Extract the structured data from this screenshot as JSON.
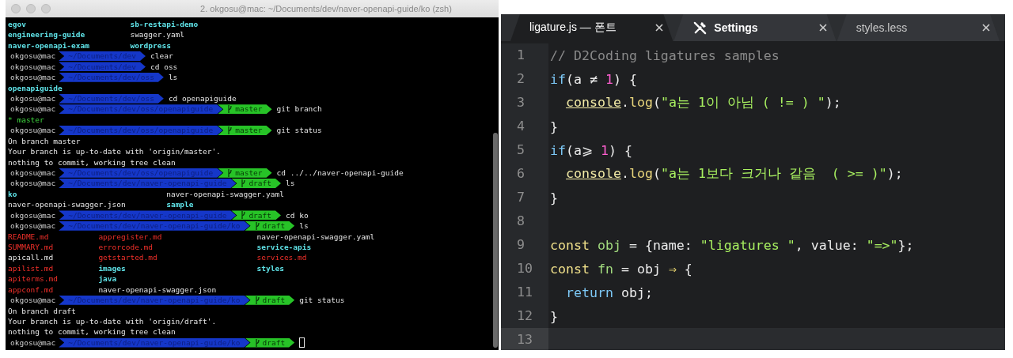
{
  "terminal": {
    "title": "2. okgosu@mac: ~/Documents/dev/naver-openapi-guide/ko (zsh)",
    "lines": [
      {
        "kind": "listing",
        "rows": [
          [
            {
              "text": "egov",
              "kind": "dir"
            },
            {
              "text": "sb-restapi-demo",
              "kind": "dir"
            }
          ],
          [
            {
              "text": "engineering-guide",
              "kind": "dir"
            },
            {
              "text": "swagger.yaml",
              "kind": "file"
            }
          ],
          [
            {
              "text": "naver-openapi-exam",
              "kind": "dir"
            },
            {
              "text": "wordpress",
              "kind": "dir"
            }
          ]
        ]
      },
      {
        "kind": "prompt",
        "user": "okgosu@mac",
        "path": "~/Documents/dev",
        "command": "clear",
        "cursor": false
      },
      {
        "kind": "prompt",
        "user": "okgosu@mac",
        "path": "~/Documents/dev",
        "command": "cd oss",
        "cursor": false
      },
      {
        "kind": "prompt",
        "user": "okgosu@mac",
        "path": "~/Documents/dev/oss",
        "command": "ls",
        "cursor": false
      },
      {
        "kind": "listing",
        "rows": [
          [
            {
              "text": "openapiguide",
              "kind": "dir"
            }
          ]
        ]
      },
      {
        "kind": "prompt",
        "user": "okgosu@mac",
        "path": "~/Documents/dev/oss",
        "command": "cd openapiguide",
        "cursor": false
      },
      {
        "kind": "prompt",
        "user": "okgosu@mac",
        "path": "~/Documents/dev/oss/openapiguide",
        "branch": "master",
        "command": "git branch",
        "cursor": false
      },
      {
        "kind": "current-branch",
        "text": "* master"
      },
      {
        "kind": "prompt",
        "user": "okgosu@mac",
        "path": "~/Documents/dev/oss/openapiguide",
        "branch": "master",
        "command": "git status",
        "cursor": false
      },
      {
        "kind": "text",
        "text": "On branch master"
      },
      {
        "kind": "text",
        "text": "Your branch is up-to-date with 'origin/master'."
      },
      {
        "kind": "text",
        "text": "nothing to commit, working tree clean"
      },
      {
        "kind": "prompt",
        "user": "okgosu@mac",
        "path": "~/Documents/dev/oss/openapiguide",
        "branch": "master",
        "command": "cd ../../naver-openapi-guide",
        "cursor": false
      },
      {
        "kind": "prompt",
        "user": "okgosu@mac",
        "path": "~/Documents/dev/naver-openapi-guide",
        "branch": "draft",
        "command": "ls",
        "cursor": false
      },
      {
        "kind": "listing",
        "rows": [
          [
            {
              "text": "ko",
              "kind": "dir"
            },
            {
              "text": "naver-openapi-swagger.yaml",
              "kind": "file"
            }
          ],
          [
            {
              "text": "naver-openapi-swagger.json",
              "kind": "file"
            },
            {
              "text": "sample",
              "kind": "dir"
            }
          ]
        ]
      },
      {
        "kind": "prompt",
        "user": "okgosu@mac",
        "path": "~/Documents/dev/naver-openapi-guide",
        "branch": "draft",
        "command": "cd ko",
        "cursor": false
      },
      {
        "kind": "prompt",
        "user": "okgosu@mac",
        "path": "~/Documents/dev/naver-openapi-guide/ko",
        "branch": "draft",
        "command": "ls",
        "cursor": false
      },
      {
        "kind": "listing",
        "rows": [
          [
            {
              "text": "README.md",
              "kind": "flagged"
            },
            {
              "text": "appregister.md",
              "kind": "flagged"
            },
            {
              "text": "naver-openapi-swagger.yaml",
              "kind": "file"
            }
          ],
          [
            {
              "text": "SUMMARY.md",
              "kind": "flagged"
            },
            {
              "text": "errorcode.md",
              "kind": "flagged"
            },
            {
              "text": "service-apis",
              "kind": "dir"
            }
          ],
          [
            {
              "text": "apicall.md",
              "kind": "file"
            },
            {
              "text": "getstarted.md",
              "kind": "flagged"
            },
            {
              "text": "services.md",
              "kind": "flagged"
            }
          ],
          [
            {
              "text": "apilist.md",
              "kind": "flagged"
            },
            {
              "text": "images",
              "kind": "dir"
            },
            {
              "text": "styles",
              "kind": "dir"
            }
          ],
          [
            {
              "text": "apiterms.md",
              "kind": "flagged"
            },
            {
              "text": "java",
              "kind": "dir"
            }
          ],
          [
            {
              "text": "appconf.md",
              "kind": "flagged"
            },
            {
              "text": "naver-openapi-swagger.json",
              "kind": "file"
            }
          ]
        ]
      },
      {
        "kind": "prompt",
        "user": "okgosu@mac",
        "path": "~/Documents/dev/naver-openapi-guide/ko",
        "branch": "draft",
        "command": "git status",
        "cursor": false
      },
      {
        "kind": "text",
        "text": "On branch draft"
      },
      {
        "kind": "text",
        "text": "Your branch is up-to-date with 'origin/draft'."
      },
      {
        "kind": "text",
        "text": "nothing to commit, working tree clean"
      },
      {
        "kind": "prompt",
        "user": "okgosu@mac",
        "path": "~/Documents/dev/naver-openapi-guide/ko",
        "branch": "draft",
        "cursor": true
      }
    ]
  },
  "editor": {
    "tabs": [
      {
        "label": "ligature.js — 폰트",
        "kind": "file",
        "selected": true
      },
      {
        "label": "Settings",
        "kind": "settings",
        "selected": false
      },
      {
        "label": "styles.less",
        "kind": "file",
        "selected": false
      }
    ],
    "lines": [
      {
        "number": "1",
        "current": false,
        "indented": false,
        "tokens": [
          {
            "kind": "comment",
            "text": "// D2Coding ligatures samples"
          }
        ]
      },
      {
        "number": "2",
        "current": false,
        "indented": false,
        "tokens": [
          {
            "kind": "keyword",
            "text": "if"
          },
          {
            "kind": "plain",
            "text": "(a "
          },
          {
            "kind": "operator",
            "text": "≠"
          },
          {
            "kind": "number",
            "text": " 1"
          },
          {
            "kind": "plain",
            "text": ") {"
          }
        ]
      },
      {
        "number": "3",
        "current": false,
        "indented": true,
        "tokens": [
          {
            "kind": "object",
            "text": "console"
          },
          {
            "kind": "plain",
            "text": "."
          },
          {
            "kind": "call",
            "text": "log"
          },
          {
            "kind": "plain",
            "text": "("
          },
          {
            "kind": "string",
            "text": "\"a는 1이 아님 ( != ) \""
          },
          {
            "kind": "plain",
            "text": ");"
          }
        ]
      },
      {
        "number": "4",
        "current": false,
        "indented": false,
        "tokens": [
          {
            "kind": "plain",
            "text": "}"
          }
        ]
      },
      {
        "number": "5",
        "current": false,
        "indented": false,
        "tokens": [
          {
            "kind": "keyword",
            "text": "if"
          },
          {
            "kind": "plain",
            "text": "(a"
          },
          {
            "kind": "operator",
            "text": "⩾"
          },
          {
            "kind": "number",
            "text": " 1"
          },
          {
            "kind": "plain",
            "text": ") {"
          }
        ]
      },
      {
        "number": "6",
        "current": false,
        "indented": true,
        "tokens": [
          {
            "kind": "object",
            "text": "console"
          },
          {
            "kind": "plain",
            "text": "."
          },
          {
            "kind": "call",
            "text": "log"
          },
          {
            "kind": "plain",
            "text": "("
          },
          {
            "kind": "string",
            "text": "\"a는 1보다 크거나 같음  ( >= )\""
          },
          {
            "kind": "plain",
            "text": ");"
          }
        ]
      },
      {
        "number": "7",
        "current": false,
        "indented": false,
        "tokens": [
          {
            "kind": "plain",
            "text": "}"
          }
        ]
      },
      {
        "number": "8",
        "current": false
      },
      {
        "number": "9",
        "current": false,
        "indented": false,
        "tokens": [
          {
            "kind": "storage",
            "text": "const"
          },
          {
            "kind": "name",
            "text": " obj"
          },
          {
            "kind": "plain",
            "text": " = {name: "
          },
          {
            "kind": "string",
            "text": "\"ligatures \""
          },
          {
            "kind": "plain",
            "text": ", value: "
          },
          {
            "kind": "string",
            "text": "\"=>\""
          },
          {
            "kind": "plain",
            "text": "};"
          }
        ]
      },
      {
        "number": "10",
        "current": false,
        "indented": false,
        "tokens": [
          {
            "kind": "storage",
            "text": "const"
          },
          {
            "kind": "name",
            "text": " fn"
          },
          {
            "kind": "plain",
            "text": " = obj "
          },
          {
            "kind": "arrow",
            "text": "⇒"
          },
          {
            "kind": "plain",
            "text": " {"
          }
        ]
      },
      {
        "number": "11",
        "current": false,
        "indented": true,
        "tokens": [
          {
            "kind": "keyword",
            "text": "return"
          },
          {
            "kind": "plain",
            "text": " obj;"
          }
        ]
      },
      {
        "number": "12",
        "current": false,
        "indented": false,
        "tokens": [
          {
            "kind": "plain",
            "text": "}"
          }
        ]
      },
      {
        "number": "13",
        "current": true
      }
    ]
  }
}
